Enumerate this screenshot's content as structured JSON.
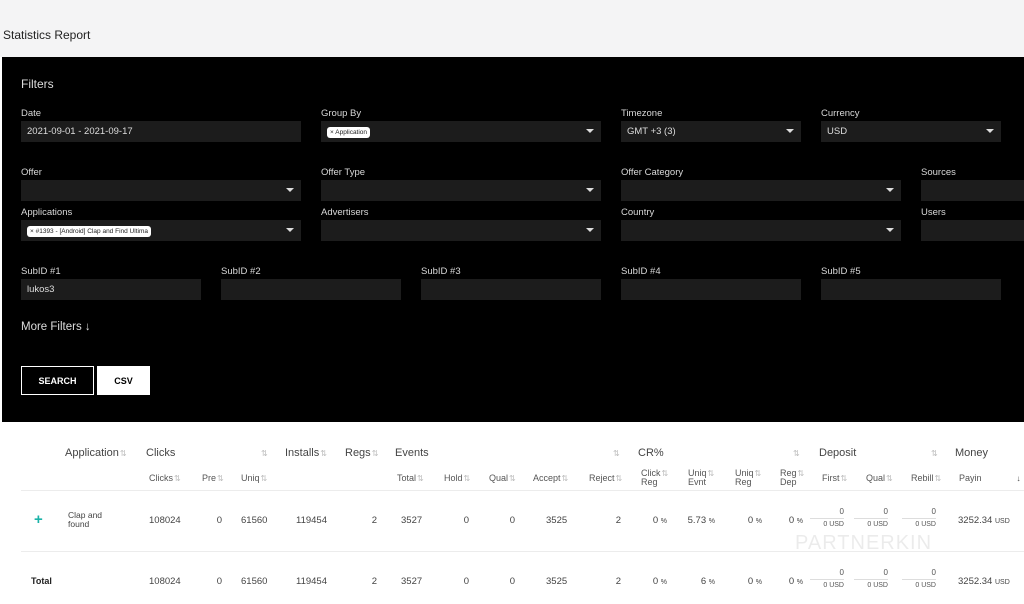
{
  "page": {
    "title": "Statistics Report"
  },
  "filters": {
    "heading": "Filters",
    "date": {
      "label": "Date",
      "value": "2021-09-01 - 2021-09-17"
    },
    "group_by": {
      "label": "Group By",
      "chip": "× Application"
    },
    "timezone": {
      "label": "Timezone",
      "value": "GMT +3 (3)"
    },
    "currency": {
      "label": "Currency",
      "value": "USD"
    },
    "offer": {
      "label": "Offer"
    },
    "offer_type": {
      "label": "Offer Type"
    },
    "offer_category": {
      "label": "Offer Category"
    },
    "sources": {
      "label": "Sources"
    },
    "applications": {
      "label": "Applications",
      "chip": "× #1393 - [Android] Clap and Find Ultima"
    },
    "advertisers": {
      "label": "Advertisers"
    },
    "country": {
      "label": "Country"
    },
    "users": {
      "label": "Users"
    },
    "subid1": {
      "label": "SubID #1",
      "value": "lukos3"
    },
    "subid2": {
      "label": "SubID #2"
    },
    "subid3": {
      "label": "SubID #3"
    },
    "subid4": {
      "label": "SubID #4"
    },
    "subid5": {
      "label": "SubID #5"
    },
    "more_filters": "More Filters ↓",
    "search_label": "SEARCH",
    "csv_label": "CSV"
  },
  "table": {
    "groups": {
      "application": "Application",
      "clicks": "Clicks",
      "installs": "Installs",
      "regs": "Regs",
      "events": "Events",
      "cr": "CR%",
      "deposit": "Deposit",
      "money": "Money"
    },
    "sub": {
      "clicks": "Clicks",
      "pre": "Pre",
      "uniq": "Uniq",
      "total": "Total",
      "hold": "Hold",
      "qual": "Qual",
      "accept": "Accept",
      "reject": "Reject",
      "click_reg_1": "Click",
      "click_reg_2": "Reg",
      "uniq_evnt_1": "Uniq",
      "uniq_evnt_2": "Evnt",
      "uniq_reg_1": "Uniq",
      "uniq_reg_2": "Reg",
      "reg_dep_1": "Reg",
      "reg_dep_2": "Dep",
      "first": "First",
      "dqual": "Qual",
      "rebill": "Rebill",
      "payin": "Payin"
    },
    "rows": [
      {
        "name": "Clap and found",
        "clicks": "108024",
        "pre": "0",
        "uniq": "61560",
        "installs": "119454",
        "regs": "2",
        "total": "3527",
        "hold": "0",
        "qual": "0",
        "accept": "3525",
        "reject": "2",
        "click_reg": "0",
        "uniq_evnt": "5.73",
        "uniq_reg": "0",
        "reg_dep": "0",
        "first": "0",
        "first_usd": "0 USD",
        "dqual": "0",
        "dqual_usd": "0 USD",
        "rebill": "0",
        "rebill_usd": "0 USD",
        "payin": "3252.34",
        "payin_cur": "USD"
      },
      {
        "name": "Total",
        "clicks": "108024",
        "pre": "0",
        "uniq": "61560",
        "installs": "119454",
        "regs": "2",
        "total": "3527",
        "hold": "0",
        "qual": "0",
        "accept": "3525",
        "reject": "2",
        "click_reg": "0",
        "uniq_evnt": "6",
        "uniq_reg": "0",
        "reg_dep": "0",
        "first": "0",
        "first_usd": "0 USD",
        "dqual": "0",
        "dqual_usd": "0 USD",
        "rebill": "0",
        "rebill_usd": "0 USD",
        "payin": "3252.34",
        "payin_cur": "USD"
      }
    ],
    "pct_sign": "%"
  },
  "watermark": "PARTNERKIN"
}
